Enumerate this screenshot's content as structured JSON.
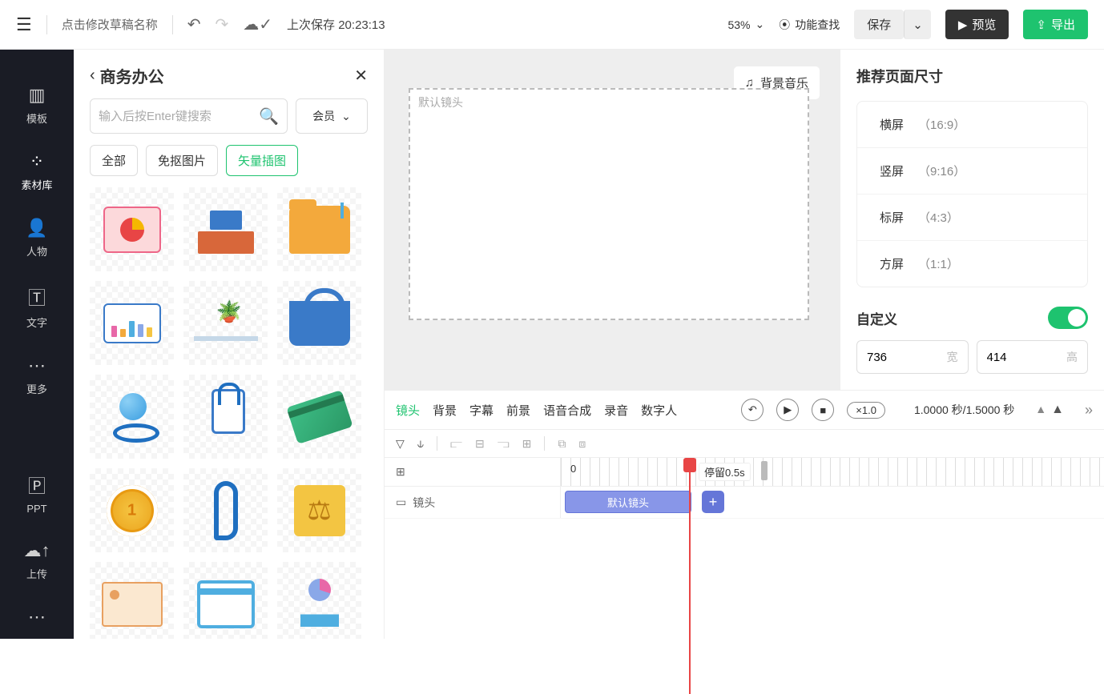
{
  "topbar": {
    "draft_name": "点击修改草稿名称",
    "save_label": "上次保存 20:23:13",
    "zoom": "53%",
    "find_label": "功能查找",
    "save_btn": "保存",
    "preview_btn": "预览",
    "export_btn": "导出"
  },
  "sidebar": {
    "items": [
      {
        "label": "模板"
      },
      {
        "label": "素材库"
      },
      {
        "label": "人物"
      },
      {
        "label": "文字"
      },
      {
        "label": "更多"
      }
    ],
    "bottom": [
      {
        "label": "PPT"
      },
      {
        "label": "上传"
      }
    ]
  },
  "assets": {
    "title": "商务办公",
    "search_placeholder": "输入后按Enter键搜索",
    "member": "会员",
    "tabs": [
      "全部",
      "免抠图片",
      "矢量插图"
    ]
  },
  "canvas": {
    "bgm": "背景音乐",
    "stage_label": "默认镜头"
  },
  "right": {
    "title": "推荐页面尺寸",
    "sizes": [
      {
        "name": "横屏",
        "ratio": "（16:9）"
      },
      {
        "name": "竖屏",
        "ratio": "（9:16）"
      },
      {
        "name": "标屏",
        "ratio": "（4:3）"
      },
      {
        "name": "方屏",
        "ratio": "（1:1）"
      }
    ],
    "custom": "自定义",
    "width": "736",
    "height": "414",
    "w_label": "宽",
    "h_label": "高"
  },
  "timeline": {
    "tabs": [
      "镜头",
      "背景",
      "字幕",
      "前景",
      "语音合成",
      "录音",
      "数字人"
    ],
    "speed": "×1.0",
    "time": "1.0000 秒/1.5000 秒",
    "ruler_zero": "0",
    "stay": "停留0.5s",
    "track_label": "镜头",
    "clip": "默认镜头"
  }
}
